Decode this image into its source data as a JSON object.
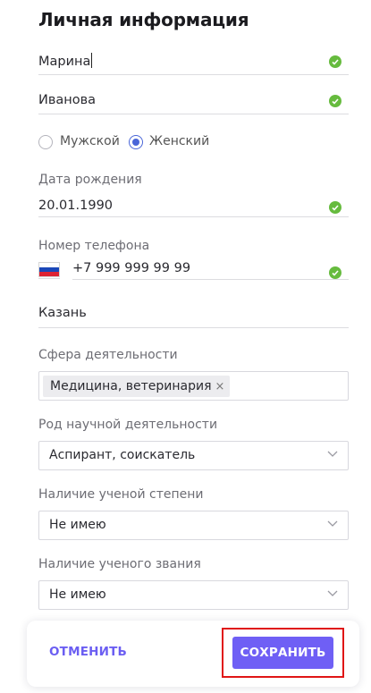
{
  "page_title": "Личная информация",
  "first_name": {
    "value": "Марина"
  },
  "last_name": {
    "value": "Иванова"
  },
  "gender": {
    "male_label": "Мужской",
    "female_label": "Женский",
    "selected": "Женский"
  },
  "birth_date": {
    "label": "Дата рождения",
    "value": "20.01.1990"
  },
  "phone": {
    "label": "Номер телефона",
    "value": "+7 999 999 99 99",
    "country_flag": "russia-flag-icon"
  },
  "city": {
    "value": "Казань"
  },
  "activity_area": {
    "label": "Сфера деятельности",
    "chips": [
      "Медицина, ветеринария"
    ],
    "chip_remove": "×"
  },
  "research_type": {
    "label": "Род научной деятельности",
    "selected": "Аспирант, соискатель"
  },
  "academic_degree": {
    "label": "Наличие ученой степени",
    "selected": "Не имею"
  },
  "academic_title": {
    "label": "Наличие ученого звания",
    "selected": "Не имею"
  },
  "footer": {
    "cancel_label": "ОТМЕНИТЬ",
    "save_label": "СОХРАНИТЬ"
  },
  "colors": {
    "accent": "#6f5ff5",
    "valid": "#66bb3e",
    "radio": "#4a66d8",
    "highlight_frame": "#e01616"
  }
}
